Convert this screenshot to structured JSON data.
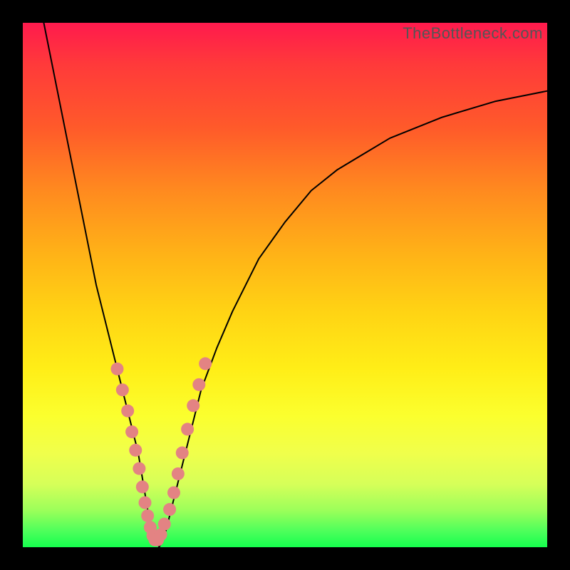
{
  "watermark": "TheBottleneck.com",
  "chart_data": {
    "type": "line",
    "title": "",
    "xlabel": "",
    "ylabel": "",
    "xlim": [
      0,
      100
    ],
    "ylim": [
      0,
      100
    ],
    "grid": false,
    "legend": false,
    "series": [
      {
        "name": "bottleneck-curve",
        "x": [
          4,
          6,
          8,
          10,
          12,
          14,
          16,
          18,
          20,
          22,
          23,
          24,
          25,
          26,
          27,
          28,
          30,
          32,
          34,
          37,
          40,
          45,
          50,
          55,
          60,
          70,
          80,
          90,
          100
        ],
        "values": [
          100,
          90,
          80,
          70,
          60,
          50,
          42,
          34,
          26,
          18,
          12,
          6,
          2,
          0,
          2,
          6,
          14,
          22,
          30,
          38,
          45,
          55,
          62,
          68,
          72,
          78,
          82,
          85,
          87
        ]
      }
    ],
    "markers": {
      "name": "highlighted-points",
      "x": [
        18,
        19,
        20,
        20.8,
        21.5,
        22.2,
        22.8,
        23.3,
        23.8,
        24.3,
        24.8,
        25.2,
        25.7,
        26.3,
        27,
        28,
        28.8,
        29.6,
        30.4,
        31.4,
        32.5,
        33.6,
        34.8
      ],
      "values": [
        34,
        30,
        26,
        22,
        18.5,
        15,
        11.5,
        8.5,
        6,
        3.8,
        2.2,
        1.4,
        1.4,
        2.4,
        4.4,
        7.2,
        10.4,
        14,
        18,
        22.5,
        27,
        31,
        35
      ]
    },
    "marker_style": {
      "fill": "#e38383",
      "radius_px": 9
    }
  }
}
